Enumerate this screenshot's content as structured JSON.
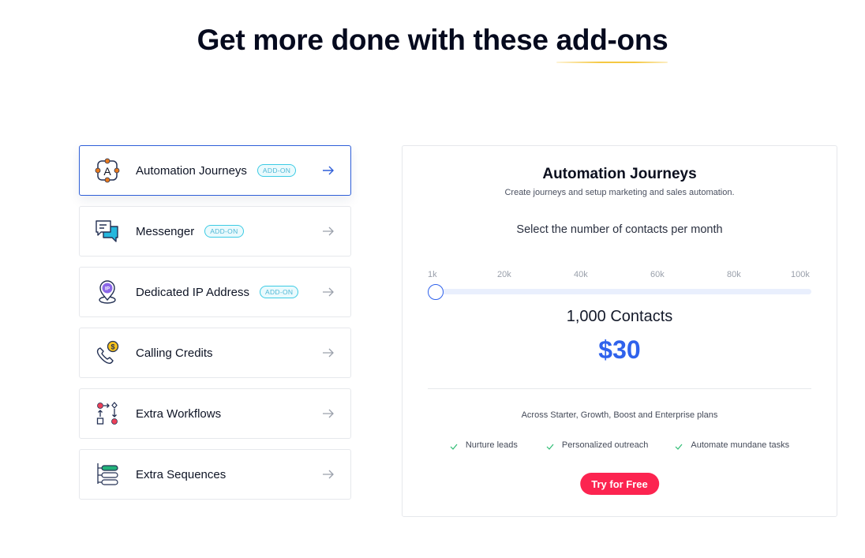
{
  "header": {
    "title_main": "Get more done with these ",
    "title_highlight": "add-ons",
    "highlight_color": "#f5c842"
  },
  "addons": [
    {
      "label": "Automation Journeys",
      "badge": "ADD-ON",
      "icon": "automation-journeys-icon",
      "active": true
    },
    {
      "label": "Messenger",
      "badge": "ADD-ON",
      "icon": "messenger-icon",
      "active": false
    },
    {
      "label": "Dedicated IP Address",
      "badge": "ADD-ON",
      "icon": "dedicated-ip-icon",
      "active": false
    },
    {
      "label": "Calling Credits",
      "badge": null,
      "icon": "calling-credits-icon",
      "active": false
    },
    {
      "label": "Extra Workflows",
      "badge": null,
      "icon": "workflows-icon",
      "active": false
    },
    {
      "label": "Extra Sequences",
      "badge": null,
      "icon": "sequences-icon",
      "active": false
    }
  ],
  "panel": {
    "title": "Automation Journeys",
    "subtitle": "Create journeys and setup marketing and sales automation.",
    "question": "Select the number of contacts per month",
    "slider": {
      "ticks": [
        "1k",
        "20k",
        "40k",
        "60k",
        "80k",
        "100k"
      ],
      "min": 1000,
      "max": 100000,
      "value": 1000
    },
    "contacts_label": "1,000 Contacts",
    "price": "$30",
    "plans_note": "Across Starter, Growth, Boost and Enterprise plans",
    "features": [
      "Nurture leads",
      "Personalized outreach",
      "Automate mundane tasks"
    ],
    "cta_label": "Try for Free"
  },
  "colors": {
    "accent_blue": "#2f62ec",
    "cta_red": "#fc2450",
    "badge_cyan": "#3ccbe4",
    "check_green": "#2ebd74"
  }
}
